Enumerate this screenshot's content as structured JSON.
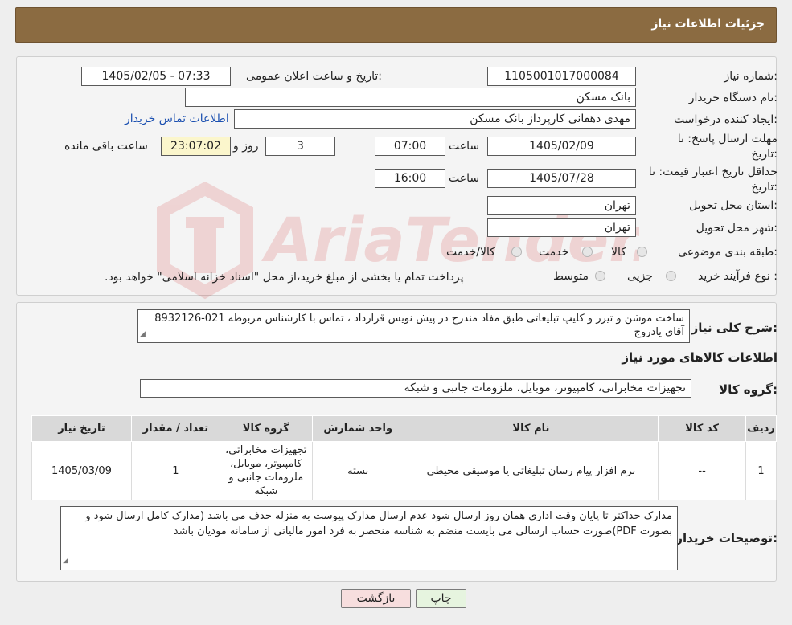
{
  "header": {
    "title": "جزئیات اطلاعات نیاز"
  },
  "form": {
    "need_number_label": "شماره نیاز:",
    "need_number": "1105001017000084",
    "announce_label": "تاریخ و ساعت اعلان عمومی:",
    "announce_value": "1405/02/05 - 07:33",
    "buyer_org_label": "نام دستگاه خریدار:",
    "buyer_org": "بانک مسکن",
    "creator_label": "ایجاد کننده درخواست:",
    "creator": "مهدی دهقانی کارپرداز بانک مسکن",
    "buyer_contact_link": "اطلاعات تماس خریدار",
    "deadline_label_1": "مهلت ارسال پاسخ: تا",
    "deadline_label_2": "تاریخ:",
    "deadline_date": "1405/02/09",
    "time_label": "ساعت",
    "deadline_time": "07:00",
    "days_value": "3",
    "days_label": "روز و",
    "remaining_time": "23:07:02",
    "remaining_label": "ساعت باقی مانده",
    "validity_label_1": "حداقل تاریخ اعتبار قیمت: تا",
    "validity_label_2": "تاریخ:",
    "validity_date": "1405/07/28",
    "validity_time": "16:00",
    "province_label": "استان محل تحویل:",
    "province": "تهران",
    "city_label": "شهر محل تحویل:",
    "city": "تهران",
    "category_label": "طبقه بندی موضوعی:",
    "category_options": [
      "کالا",
      "خدمت",
      "کالا/خدمت"
    ],
    "process_label": "نوع فرآیند خرید :",
    "process_options": [
      "جزیی",
      "متوسط"
    ],
    "process_note": "پرداخت تمام یا بخشی از مبلغ خرید،از محل \"اسناد خزانه اسلامی\" خواهد بود."
  },
  "details": {
    "summary_label": "شرح کلی نیاز:",
    "summary": "ساخت موشن و تیزر و کلیپ تبلیغاتی طبق مفاد مندرج در پیش نویس قرارداد ، تماس با کارشناس مربوطه 021-8932126 آقای یادروج",
    "goods_info_title": "اطلاعات کالاهای مورد نیاز",
    "goods_group_label": "گروه کالا:",
    "goods_group": "تجهیزات مخابراتی، کامپیوتر، موبایل، ملزومات جانبی و شبکه",
    "table": {
      "headers": [
        "ردیف",
        "کد کالا",
        "نام کالا",
        "واحد شمارش",
        "گروه کالا",
        "تعداد / مقدار",
        "تاریخ نیاز"
      ],
      "rows": [
        [
          "1",
          "--",
          "نرم افزار پیام رسان تبلیغاتی یا موسیقی محیطی",
          "بسته",
          "تجهیزات مخابراتی، کامپیوتر، موبایل، ملزومات جانبی و شبکه",
          "1",
          "1405/03/09"
        ]
      ]
    },
    "buyer_notes_label": "توضیحات خریدار:",
    "buyer_notes": "مدارک حداکثر تا پایان وقت اداری همان روز ارسال شود عدم ارسال مدارک پیوست به منزله حذف می باشد (مدارک کامل ارسال شود و بصورت PDF)صورت حساب ارسالی می بایست منضم به شناسه منحصر به فرد امور مالیاتی از سامانه مودیان باشد"
  },
  "buttons": {
    "print": "چاپ",
    "back": "بازگشت"
  },
  "watermark": {
    "text": "AriaTender.neT"
  },
  "colors": {
    "header_bg": "#8b6b41",
    "link": "#1a4fb0",
    "remaining_bg": "#fbf6cc",
    "back_button_bg": "#f7dede",
    "print_button_bg": "#e6f4df"
  }
}
